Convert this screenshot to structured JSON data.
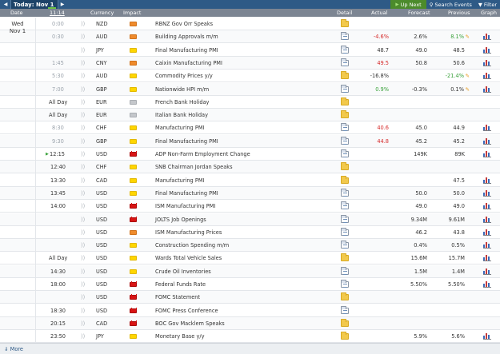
{
  "topbar": {
    "prev_icon": "triangle-left-icon",
    "today_label": "Today: Nov 1",
    "next_icon": "triangle-right-icon",
    "up_next": "Up Next",
    "search_events": "Search Events",
    "filter": "Filter"
  },
  "header": {
    "date": "Date",
    "time": "11:14",
    "currency": "Currency",
    "impact": "Impact",
    "detail": "Detail",
    "actual": "Actual",
    "forecast": "Forecast",
    "previous": "Previous",
    "graph": "Graph"
  },
  "date_cell": {
    "weekday": "Wed",
    "date": "Nov 1"
  },
  "colors": {
    "topbar": "#2e5a86",
    "header": "#7c8592",
    "negative": "#d62b2b",
    "positive": "#39a13a",
    "up_next": "#4c8b2b"
  },
  "rows": [
    {
      "time": "0:00",
      "time_style": "grey",
      "currency": "NZD",
      "impact": "med",
      "event": "RBNZ Gov Orr Speaks",
      "detail": "folder",
      "actual": "",
      "actual_style": "",
      "forecast": "",
      "previous": "",
      "previous_style": "",
      "previous_revised": false,
      "graph": false
    },
    {
      "time": "0:30",
      "time_style": "grey",
      "currency": "AUD",
      "impact": "med",
      "event": "Building Approvals m/m",
      "detail": "doc",
      "actual": "-4.6%",
      "actual_style": "neg",
      "forecast": "2.6%",
      "previous": "8.1%",
      "previous_style": "pos",
      "previous_revised": true,
      "graph": true
    },
    {
      "time": "",
      "time_style": "grey",
      "currency": "JPY",
      "impact": "low",
      "event": "Final Manufacturing PMI",
      "detail": "doc",
      "actual": "48.7",
      "actual_style": "",
      "forecast": "49.0",
      "previous": "48.5",
      "previous_style": "",
      "previous_revised": false,
      "graph": true
    },
    {
      "time": "1:45",
      "time_style": "grey",
      "currency": "CNY",
      "impact": "med",
      "event": "Caixin Manufacturing PMI",
      "detail": "doc",
      "actual": "49.5",
      "actual_style": "neg",
      "forecast": "50.8",
      "previous": "50.6",
      "previous_style": "",
      "previous_revised": false,
      "graph": true
    },
    {
      "time": "5:30",
      "time_style": "grey",
      "currency": "AUD",
      "impact": "low",
      "event": "Commodity Prices y/y",
      "detail": "folder",
      "actual": "-16.8%",
      "actual_style": "",
      "forecast": "",
      "previous": "-21.4%",
      "previous_style": "pos",
      "previous_revised": true,
      "graph": true
    },
    {
      "time": "7:00",
      "time_style": "grey",
      "currency": "GBP",
      "impact": "low",
      "event": "Nationwide HPI m/m",
      "detail": "doc",
      "actual": "0.9%",
      "actual_style": "pos",
      "forecast": "-0.3%",
      "previous": "0.1%",
      "previous_style": "",
      "previous_revised": true,
      "graph": true
    },
    {
      "time": "All Day",
      "time_style": "plain",
      "currency": "EUR",
      "impact": "none",
      "event": "French Bank Holiday",
      "detail": "folder",
      "actual": "",
      "actual_style": "",
      "forecast": "",
      "previous": "",
      "previous_style": "",
      "previous_revised": false,
      "graph": false
    },
    {
      "time": "All Day",
      "time_style": "plain",
      "currency": "EUR",
      "impact": "none",
      "event": "Italian Bank Holiday",
      "detail": "folder",
      "actual": "",
      "actual_style": "",
      "forecast": "",
      "previous": "",
      "previous_style": "",
      "previous_revised": false,
      "graph": false
    },
    {
      "time": "8:30",
      "time_style": "grey",
      "currency": "CHF",
      "impact": "low",
      "event": "Manufacturing PMI",
      "detail": "doc",
      "actual": "40.6",
      "actual_style": "neg",
      "forecast": "45.0",
      "previous": "44.9",
      "previous_style": "",
      "previous_revised": false,
      "graph": true
    },
    {
      "time": "9:30",
      "time_style": "grey",
      "currency": "GBP",
      "impact": "low",
      "event": "Final Manufacturing PMI",
      "detail": "doc",
      "actual": "44.8",
      "actual_style": "neg",
      "forecast": "45.2",
      "previous": "45.2",
      "previous_style": "",
      "previous_revised": false,
      "graph": true
    },
    {
      "time": "12:15",
      "time_style": "plain",
      "current": true,
      "currency": "USD",
      "impact": "high",
      "event": "ADP Non-Farm Employment Change",
      "detail": "doc",
      "actual": "",
      "actual_style": "",
      "forecast": "149K",
      "previous": "89K",
      "previous_style": "",
      "previous_revised": false,
      "graph": true
    },
    {
      "time": "12:40",
      "time_style": "plain",
      "currency": "CHF",
      "impact": "low",
      "event": "SNB Chairman Jordan Speaks",
      "detail": "folder",
      "actual": "",
      "actual_style": "",
      "forecast": "",
      "previous": "",
      "previous_style": "",
      "previous_revised": false,
      "graph": false
    },
    {
      "time": "13:30",
      "time_style": "plain",
      "currency": "CAD",
      "impact": "low",
      "event": "Manufacturing PMI",
      "detail": "folder",
      "actual": "",
      "actual_style": "",
      "forecast": "",
      "previous": "47.5",
      "previous_style": "",
      "previous_revised": false,
      "graph": true
    },
    {
      "time": "13:45",
      "time_style": "plain",
      "currency": "USD",
      "impact": "low",
      "event": "Final Manufacturing PMI",
      "detail": "doc",
      "actual": "",
      "actual_style": "",
      "forecast": "50.0",
      "previous": "50.0",
      "previous_style": "",
      "previous_revised": false,
      "graph": true
    },
    {
      "time": "14:00",
      "time_style": "plain",
      "currency": "USD",
      "impact": "high",
      "event": "ISM Manufacturing PMI",
      "detail": "doc",
      "actual": "",
      "actual_style": "",
      "forecast": "49.0",
      "previous": "49.0",
      "previous_style": "",
      "previous_revised": false,
      "graph": true
    },
    {
      "time": "",
      "time_style": "plain",
      "currency": "USD",
      "impact": "high",
      "event": "JOLTS Job Openings",
      "detail": "doc",
      "actual": "",
      "actual_style": "",
      "forecast": "9.34M",
      "previous": "9.61M",
      "previous_style": "",
      "previous_revised": false,
      "graph": true
    },
    {
      "time": "",
      "time_style": "plain",
      "currency": "USD",
      "impact": "med",
      "event": "ISM Manufacturing Prices",
      "detail": "doc",
      "actual": "",
      "actual_style": "",
      "forecast": "46.2",
      "previous": "43.8",
      "previous_style": "",
      "previous_revised": false,
      "graph": true
    },
    {
      "time": "",
      "time_style": "plain",
      "currency": "USD",
      "impact": "low",
      "event": "Construction Spending m/m",
      "detail": "doc",
      "actual": "",
      "actual_style": "",
      "forecast": "0.4%",
      "previous": "0.5%",
      "previous_style": "",
      "previous_revised": false,
      "graph": true
    },
    {
      "time": "All Day",
      "time_style": "plain",
      "currency": "USD",
      "impact": "low",
      "event": "Wards Total Vehicle Sales",
      "detail": "folder",
      "actual": "",
      "actual_style": "",
      "forecast": "15.6M",
      "previous": "15.7M",
      "previous_style": "",
      "previous_revised": false,
      "graph": true
    },
    {
      "time": "14:30",
      "time_style": "plain",
      "currency": "USD",
      "impact": "low",
      "event": "Crude Oil Inventories",
      "detail": "doc",
      "actual": "",
      "actual_style": "",
      "forecast": "1.5M",
      "previous": "1.4M",
      "previous_style": "",
      "previous_revised": false,
      "graph": true
    },
    {
      "time": "18:00",
      "time_style": "plain",
      "currency": "USD",
      "impact": "high",
      "event": "Federal Funds Rate",
      "detail": "doc",
      "actual": "",
      "actual_style": "",
      "forecast": "5.50%",
      "previous": "5.50%",
      "previous_style": "",
      "previous_revised": false,
      "graph": true
    },
    {
      "time": "",
      "time_style": "plain",
      "currency": "USD",
      "impact": "high",
      "event": "FOMC Statement",
      "detail": "folder",
      "actual": "",
      "actual_style": "",
      "forecast": "",
      "previous": "",
      "previous_style": "",
      "previous_revised": false,
      "graph": false
    },
    {
      "time": "18:30",
      "time_style": "plain",
      "currency": "USD",
      "impact": "high",
      "event": "FOMC Press Conference",
      "detail": "doc",
      "actual": "",
      "actual_style": "",
      "forecast": "",
      "previous": "",
      "previous_style": "",
      "previous_revised": false,
      "graph": false
    },
    {
      "time": "20:15",
      "time_style": "plain",
      "currency": "CAD",
      "impact": "high",
      "event": "BOC Gov Macklem Speaks",
      "detail": "folder",
      "actual": "",
      "actual_style": "",
      "forecast": "",
      "previous": "",
      "previous_style": "",
      "previous_revised": false,
      "graph": false
    },
    {
      "time": "23:50",
      "time_style": "plain",
      "currency": "JPY",
      "impact": "low",
      "event": "Monetary Base y/y",
      "detail": "folder",
      "actual": "",
      "actual_style": "",
      "forecast": "5.9%",
      "previous": "5.6%",
      "previous_style": "",
      "previous_revised": false,
      "graph": true
    }
  ],
  "footer": {
    "more_label": "More"
  }
}
